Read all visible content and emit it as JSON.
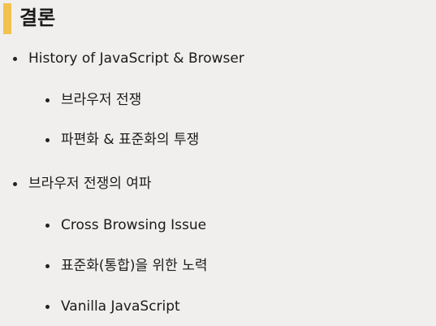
{
  "slide": {
    "title": "결론",
    "accent_color": "#f2c14e",
    "sections": [
      {
        "text": "History of JavaScript & Browser",
        "subitems": [
          "브라우저 전쟁",
          "파편화 & 표준화의 투쟁"
        ]
      },
      {
        "text": "브라우저 전쟁의 여파",
        "subitems": [
          "Cross Browsing Issue",
          "표준화(통합)을 위한 노력",
          "Vanilla JavaScript"
        ]
      }
    ]
  }
}
